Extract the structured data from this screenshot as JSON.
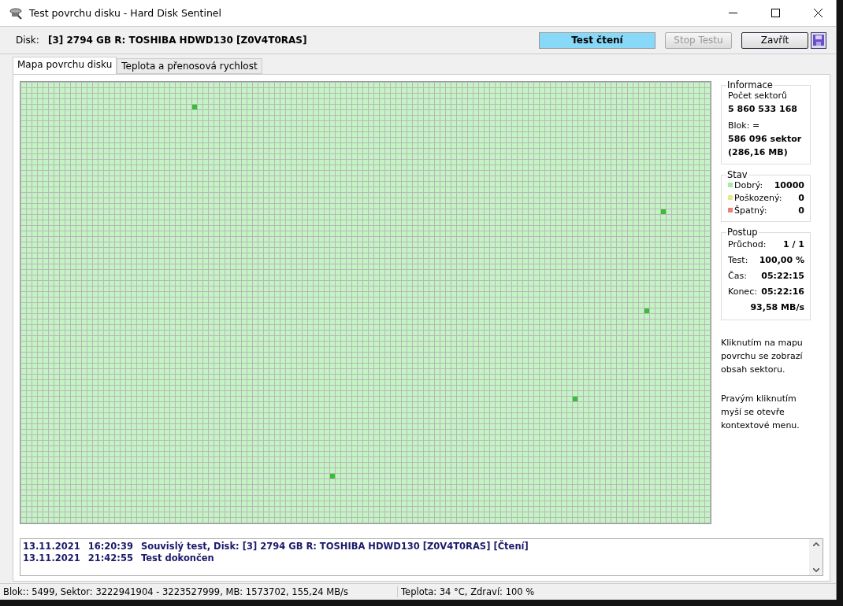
{
  "window": {
    "title": "Test povrchu disku - Hard Disk Sentinel"
  },
  "header": {
    "disk_label": "Disk:",
    "disk_value": "[3] 2794 GB R: TOSHIBA HDWD130 [Z0V4T0RAS]",
    "buttons": [
      {
        "label": "Test čtení",
        "kind": "status"
      },
      {
        "label": "Stop Testu",
        "kind": "push",
        "disabled": true
      },
      {
        "label": "Zavřít",
        "kind": "push",
        "disabled": false
      }
    ]
  },
  "tabs": [
    {
      "label": "Mapa povrchu disku",
      "selected": true
    },
    {
      "label": "Teplota a přenosová rychlost",
      "selected": false
    }
  ],
  "info": {
    "title": "Informace",
    "sectors_label": "Počet sektorů",
    "sectors_value": "5 860 533 168",
    "block_label": "Blok: =",
    "block_value": "586 096 sektor",
    "block_size": "(286,16 MB)"
  },
  "state": {
    "title": "Stav",
    "items": [
      {
        "label": "Dobrý:",
        "value": "10000",
        "color": "#a8e8a8"
      },
      {
        "label": "Poškozený:",
        "value": "0",
        "color": "#e8e890"
      },
      {
        "label": "Špatný:",
        "value": "0",
        "color": "#e88080"
      }
    ]
  },
  "progress": {
    "title": "Postup",
    "rows": [
      {
        "label": "Průchod:",
        "value": "1 / 1"
      },
      {
        "label": "Test:",
        "value": "100,00 %"
      },
      {
        "label": "Čas:",
        "value": "05:22:15"
      },
      {
        "label": "Konec:",
        "value": "05:22:16"
      },
      {
        "value": "93,58 MB/s"
      }
    ]
  },
  "hints": [
    "Kliknutím na mapu povrchu se zobrazí obsah sektoru.",
    "Pravým kliknutím myší se otevře kontextové menu."
  ],
  "log": [
    {
      "date": "13.11.2021",
      "time": "16:20:39",
      "message": "Souvislý test, Disk: [3] 2794 GB R: TOSHIBA HDWD130 [Z0V4T0RAS] [Čtení]"
    },
    {
      "date": "13.11.2021",
      "time": "21:42:55",
      "message": "Test dokončen"
    }
  ],
  "status_bar": [
    "Blok:: 5499, Sektor: 3222941904 - 3223527999, MB: 1573702, 155,24 MB/s",
    "Teplota: 34  °C,  Zdraví: 100 %"
  ]
}
